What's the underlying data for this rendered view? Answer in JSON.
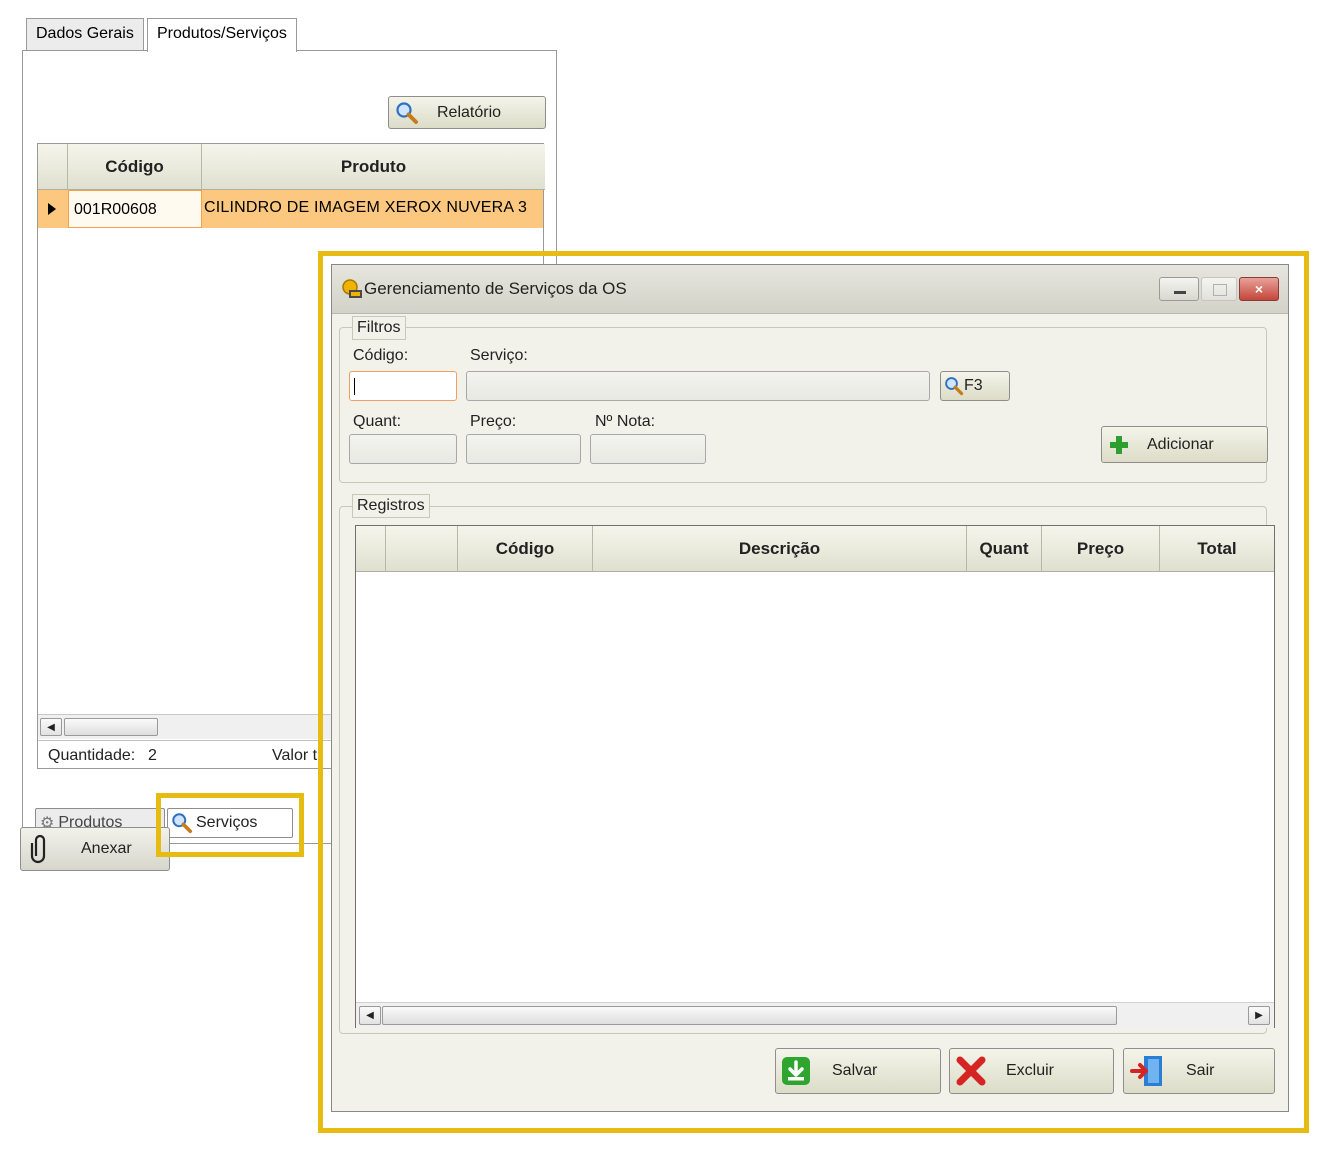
{
  "tabs": [
    {
      "label": "Dados Gerais",
      "active": false
    },
    {
      "label": "Produtos/Serviços",
      "active": true
    }
  ],
  "products_panel": {
    "relatorio_button": "Relatório",
    "grid": {
      "columns": [
        "Código",
        "Produto"
      ],
      "rows": [
        {
          "codigo": "001R00608",
          "produto": "CILINDRO DE IMAGEM XEROX NUVERA 3",
          "selected": true
        }
      ]
    },
    "quantidade_label": "Quantidade:",
    "quantidade_value": "2",
    "valor_label": "Valor t",
    "bottom_tabs": [
      "Produtos",
      "Serviços"
    ],
    "anexar_button": "Anexar"
  },
  "dialog": {
    "title": "Gerenciamento de Serviços da OS",
    "filtros": {
      "legend": "Filtros",
      "codigo_label": "Código:",
      "codigo_value": "",
      "servico_label": "Serviço:",
      "servico_value": "",
      "search_button": "F3",
      "quant_label": "Quant:",
      "preco_label": "Preço:",
      "nota_label": "Nº Nota:",
      "adicionar_button": "Adicionar"
    },
    "registros": {
      "legend": "Registros",
      "columns": [
        "",
        "",
        "Código",
        "Descrição",
        "Quant",
        "Preço",
        "Total"
      ],
      "rows": []
    },
    "buttons": {
      "salvar": "Salvar",
      "excluir": "Excluir",
      "sair": "Sair"
    }
  },
  "colors": {
    "highlight": "#e6bc12",
    "selected_row": "#fcc77e",
    "selected_cell_border": "#f5a24a"
  }
}
